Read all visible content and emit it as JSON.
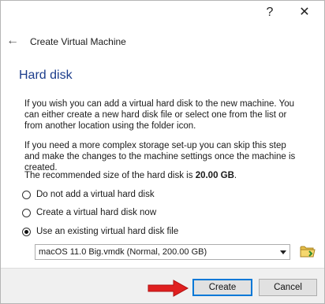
{
  "window": {
    "help_symbol": "?",
    "close_symbol": "✕"
  },
  "header": {
    "back_symbol": "←",
    "title": "Create Virtual Machine"
  },
  "section": {
    "title": "Hard disk"
  },
  "body": {
    "paragraph1": "If you wish you can add a virtual hard disk to the new machine. You can either create a new hard disk file or select one from the list or from another location using the folder icon.",
    "paragraph2": "If you need a more complex storage set-up you can skip this step and make the changes to the machine settings once the machine is created.",
    "recommended_prefix": "The recommended size of the hard disk is ",
    "recommended_size": "20.00 GB",
    "recommended_suffix": "."
  },
  "options": [
    {
      "label": "Do not add a virtual hard disk",
      "checked": false
    },
    {
      "label": "Create a virtual hard disk now",
      "checked": false
    },
    {
      "label": "Use an existing virtual hard disk file",
      "checked": true
    }
  ],
  "disk_select": {
    "value": "macOS 11.0 Big.vmdk (Normal, 200.00 GB)"
  },
  "buttons": {
    "create": "Create",
    "cancel": "Cancel"
  },
  "colors": {
    "section_title": "#1c3d8c",
    "default_button_border": "#0078d7",
    "annotation_arrow": "#e02020"
  },
  "icons": {
    "help": "question-mark-icon",
    "close": "close-icon",
    "back": "back-arrow-icon",
    "folder": "folder-icon",
    "dropdown": "chevron-down-icon",
    "annotation": "red-arrow-icon"
  }
}
